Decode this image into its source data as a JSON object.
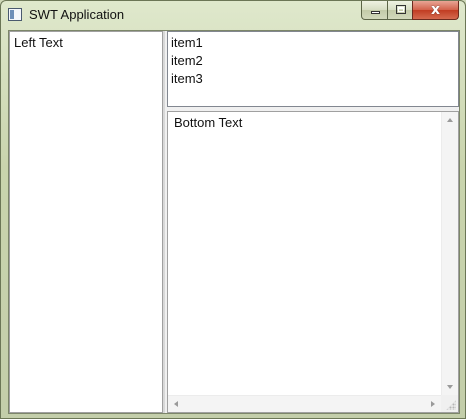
{
  "window": {
    "title": "SWT Application",
    "close_glyph": "x"
  },
  "left_pane": {
    "text": "Left Text"
  },
  "list": {
    "items": [
      "item1",
      "item2",
      "item3"
    ]
  },
  "bottom_pane": {
    "text": "Bottom Text"
  },
  "icons": {
    "app": "app-window-icon",
    "minimize": "minimize-icon",
    "maximize": "maximize-icon",
    "close": "close-icon"
  }
}
